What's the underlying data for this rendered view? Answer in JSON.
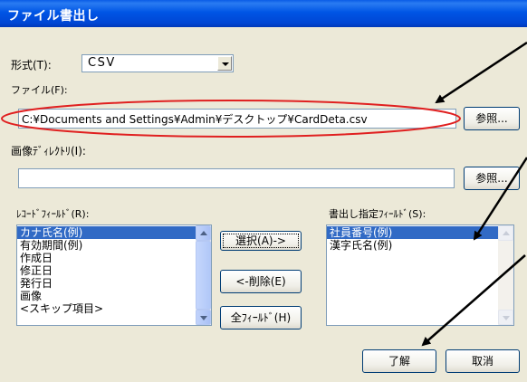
{
  "window": {
    "title": "ファイル書出し"
  },
  "format": {
    "label": "形式(T):",
    "value": "CSV"
  },
  "file": {
    "label": "ファイル(F):",
    "path": "C:¥Documents and Settings¥Admin¥デスクトップ¥CardDeta.csv",
    "browse_label": "参照..."
  },
  "image_dir": {
    "label": "画像ﾃﾞｨﾚｸﾄﾘ(I):",
    "path": "",
    "browse_label": "参照..."
  },
  "record_fields": {
    "label": "ﾚｺｰﾄﾞﾌｨｰﾙﾄﾞ(R):",
    "items": [
      "カナ氏名(例)",
      "有効期間(例)",
      "作成日",
      "修正日",
      "発行日",
      "画像",
      "<スキップ項目>"
    ],
    "selected_index": 0
  },
  "export_fields": {
    "label": "書出し指定ﾌｨｰﾙﾄﾞ(S):",
    "items": [
      "社員番号(例)",
      "漢字氏名(例)"
    ],
    "selected_index": 0
  },
  "actions": {
    "select_label": "選択(A)->",
    "delete_label": "<-削除(E)",
    "all_fields_label": "全ﾌｨｰﾙﾄﾞ(H)"
  },
  "footer": {
    "ok_label": "了解",
    "cancel_label": "取消"
  },
  "colors": {
    "title_bar": "#0055e5",
    "selection": "#316ac5",
    "annotation_arrow": "#000000",
    "annotation_ellipse": "#e02020",
    "dialog_bg": "#ece9d8"
  }
}
